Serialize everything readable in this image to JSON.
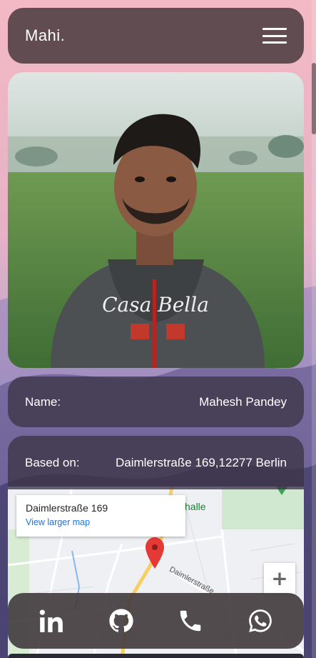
{
  "app": {
    "brand": "Mahi."
  },
  "header": {
    "menu_icon": "hamburger-menu-icon"
  },
  "profile": {
    "name_label": "Name:",
    "name_value": "Mahesh Pandey",
    "location_label": "Based on:",
    "location_value": "Daimlerstraße 169,12277 Berlin"
  },
  "map": {
    "info_address": "Daimlerstraße 169",
    "info_link": "View larger map",
    "zoom_in": "+",
    "street_label": "Daimlerstraße",
    "poi_label": "halle",
    "marker_icon": "map-pin-icon"
  },
  "dock": {
    "icons": [
      "linkedin-icon",
      "github-icon",
      "phone-icon",
      "whatsapp-icon"
    ]
  },
  "colors": {
    "card_bg": "#483c40",
    "accent_pin": "#e53935",
    "link": "#1a73e8"
  }
}
